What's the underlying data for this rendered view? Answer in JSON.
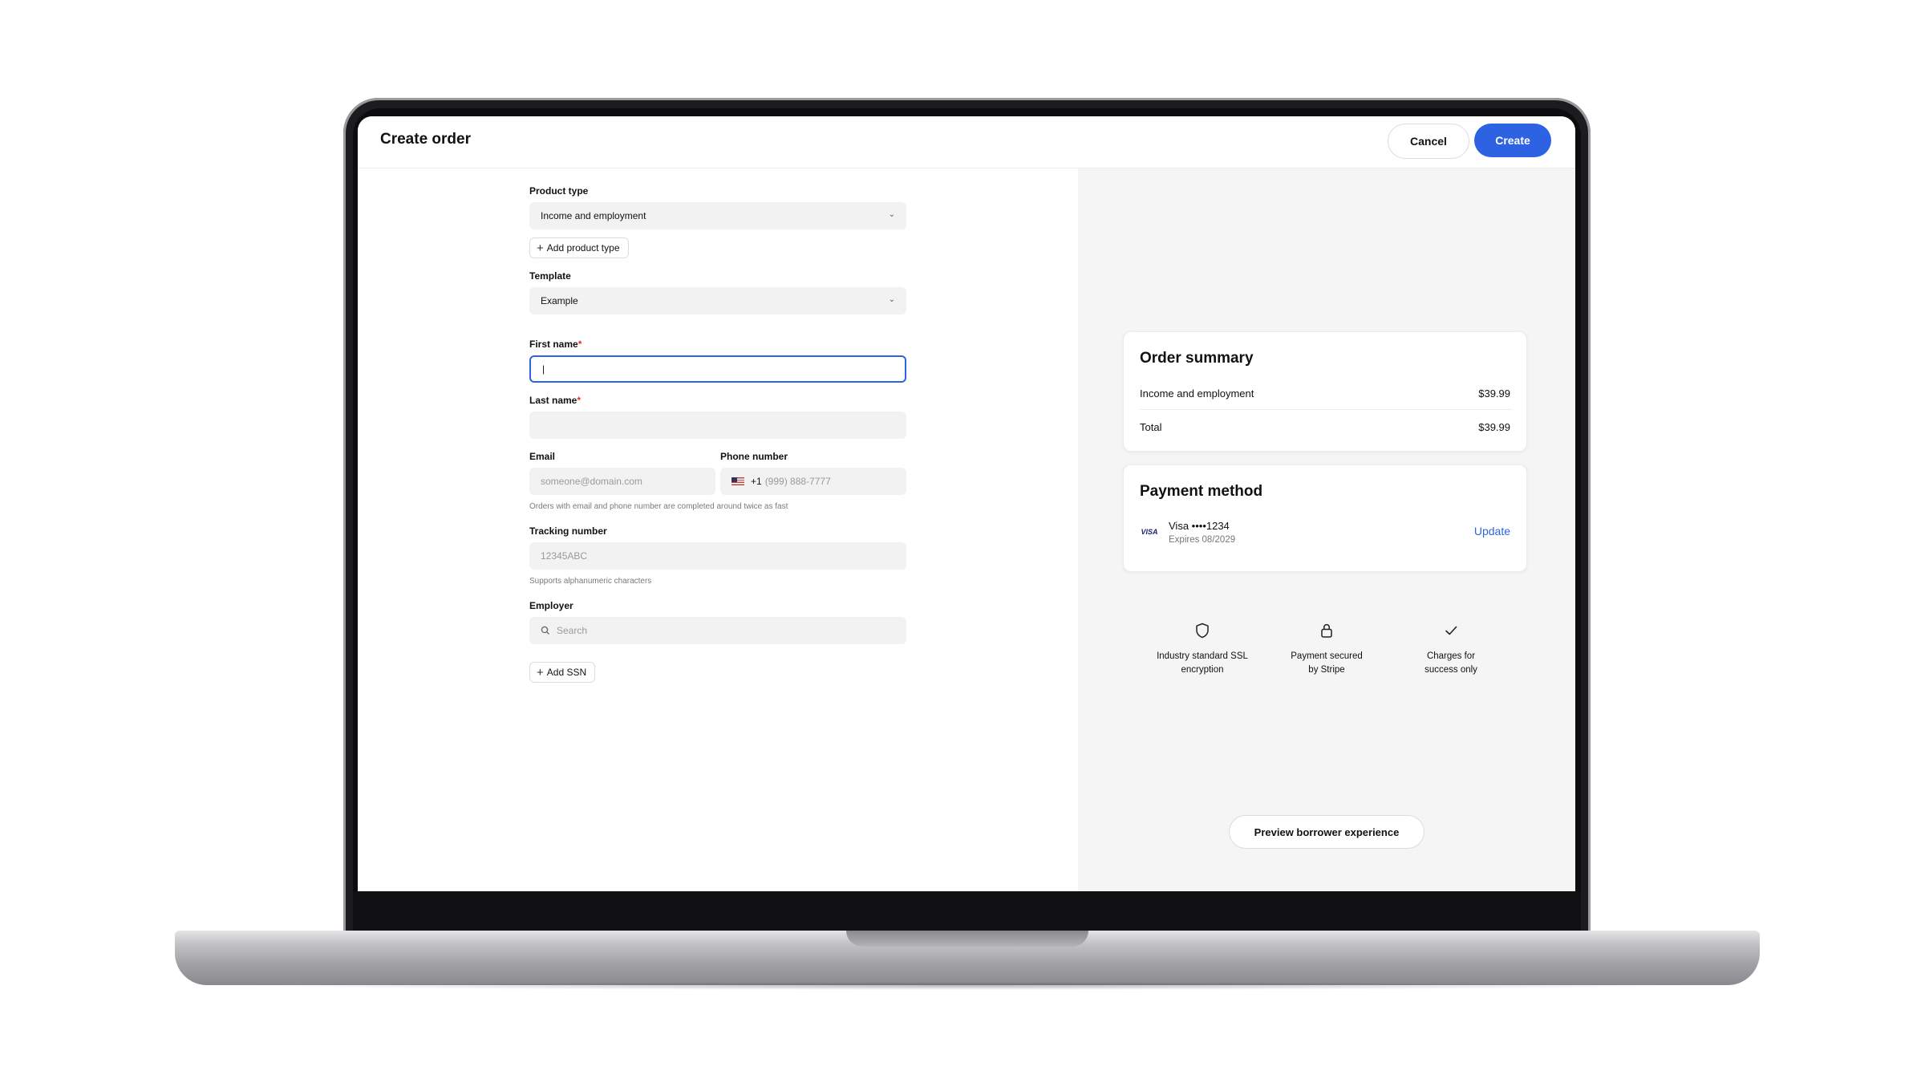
{
  "header": {
    "title": "Create order",
    "cancel_label": "Cancel",
    "create_label": "Create"
  },
  "form": {
    "product_type": {
      "label": "Product type",
      "value": "Income and employment",
      "add_label": "Add product type"
    },
    "template": {
      "label": "Template",
      "value": "Example"
    },
    "first_name": {
      "label": "First name",
      "required_mark": "*",
      "value": "|"
    },
    "last_name": {
      "label": "Last name",
      "required_mark": "*",
      "value": ""
    },
    "email": {
      "label": "Email",
      "placeholder": "someone@domain.com"
    },
    "phone": {
      "label": "Phone number",
      "country_code": "+1",
      "placeholder": "(999) 888-7777"
    },
    "contact_hint": "Orders with email and phone number are completed around twice as fast",
    "tracking": {
      "label": "Tracking number",
      "placeholder": "12345ABC",
      "hint": "Supports alphanumeric characters"
    },
    "employer": {
      "label": "Employer",
      "placeholder": "Search"
    },
    "add_ssn_label": "Add SSN"
  },
  "order_summary": {
    "title": "Order summary",
    "items": [
      {
        "name": "Income and employment",
        "price": "$39.99"
      }
    ],
    "total_label": "Total",
    "total_value": "$39.99"
  },
  "payment": {
    "title": "Payment method",
    "brand": "VISA",
    "card_label": "Visa ••••1234",
    "expiry": "Expires 08/2029",
    "update_label": "Update"
  },
  "trust": [
    {
      "icon": "shield-icon",
      "line1": "Industry standard SSL",
      "line2": "encryption"
    },
    {
      "icon": "lock-icon",
      "line1": "Payment secured",
      "line2": "by Stripe"
    },
    {
      "icon": "check-icon",
      "line1": "Charges for",
      "line2": "success only"
    }
  ],
  "preview_label": "Preview borrower experience",
  "colors": {
    "accent": "#2d62e3",
    "panel_bg": "#f5f5f5",
    "field_bg": "#f2f2f2"
  }
}
